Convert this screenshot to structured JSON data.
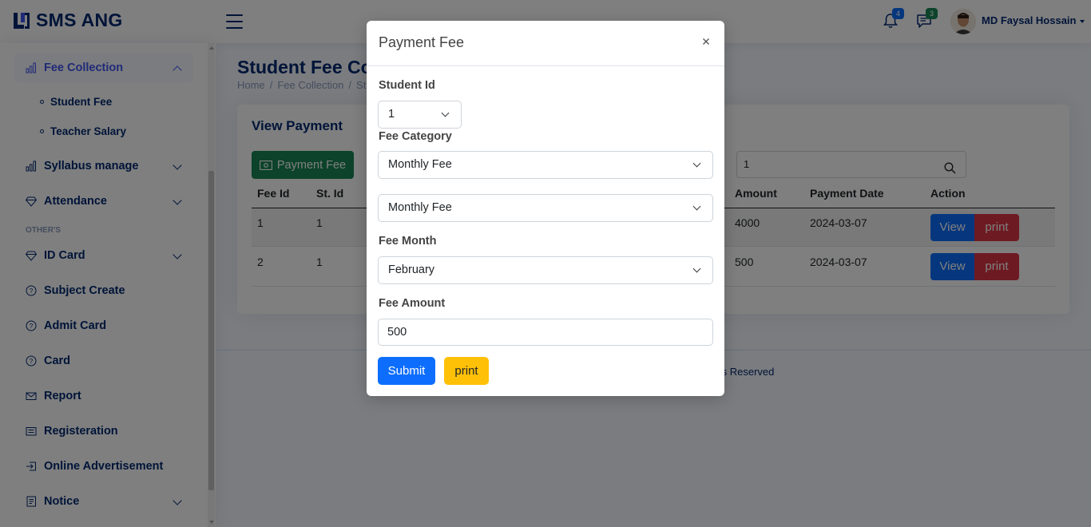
{
  "app": {
    "logo_text": "SMS ANG"
  },
  "header": {
    "notifications_count": "4",
    "messages_count": "3",
    "user_name": "MD Faysal Hossain",
    "colors": {
      "notif_badge": "#0d6efd",
      "msg_badge": "#198754"
    }
  },
  "sidebar": {
    "items": [
      {
        "label": "Fee Collection",
        "icon": "bar-chart-icon",
        "active": true,
        "has_children": true
      },
      {
        "label": "Syllabus manage",
        "icon": "bar-chart-icon",
        "has_children": true
      },
      {
        "label": "Attendance",
        "icon": "gem-icon",
        "has_children": true
      },
      {
        "label": "ID Card",
        "icon": "gem-icon",
        "has_children": true
      },
      {
        "label": "Subject Create",
        "icon": "question-circle-icon"
      },
      {
        "label": "Admit Card",
        "icon": "question-circle-icon"
      },
      {
        "label": "Card",
        "icon": "question-circle-icon"
      },
      {
        "label": "Report",
        "icon": "envelope-icon"
      },
      {
        "label": "Registeration",
        "icon": "card-list-icon"
      },
      {
        "label": "Online Advertisement",
        "icon": "box-arrow-in-right-icon"
      },
      {
        "label": "Notice",
        "icon": "journal-text-icon",
        "has_children": true
      }
    ],
    "sub_items": [
      "Student Fee",
      "Teacher Salary"
    ],
    "heading": "OTHER'S"
  },
  "main": {
    "page_title": "Student Fee Coll",
    "breadcrumb": [
      "Home",
      "Fee Collection",
      "St"
    ],
    "card_title": "View Payment",
    "payment_fee_button": "Payment Fee",
    "search_value": "1",
    "table": {
      "headers": [
        "Fee Id",
        "St. Id",
        "Amount",
        "Payment Date",
        "Action"
      ],
      "rows": [
        {
          "fee_id": "1",
          "st_id": "1",
          "amount": "4000",
          "payment_date": "2024-03-07"
        },
        {
          "fee_id": "2",
          "st_id": "1",
          "amount": "500",
          "payment_date": "2024-03-07"
        }
      ],
      "view_label": "View",
      "print_label": "print"
    },
    "footer_text": "ts Reserved"
  },
  "modal": {
    "title": "Payment Fee",
    "student_id_label": "Student Id",
    "student_id_value": "1",
    "fee_category_label": "Fee Category",
    "fee_category_value": "Monthly Fee",
    "fee_type_value": "Monthly Fee",
    "fee_month_label": "Fee Month",
    "fee_month_value": "February",
    "fee_amount_label": "Fee Amount",
    "fee_amount_value": "500",
    "submit_label": "Submit",
    "print_label": "print"
  }
}
